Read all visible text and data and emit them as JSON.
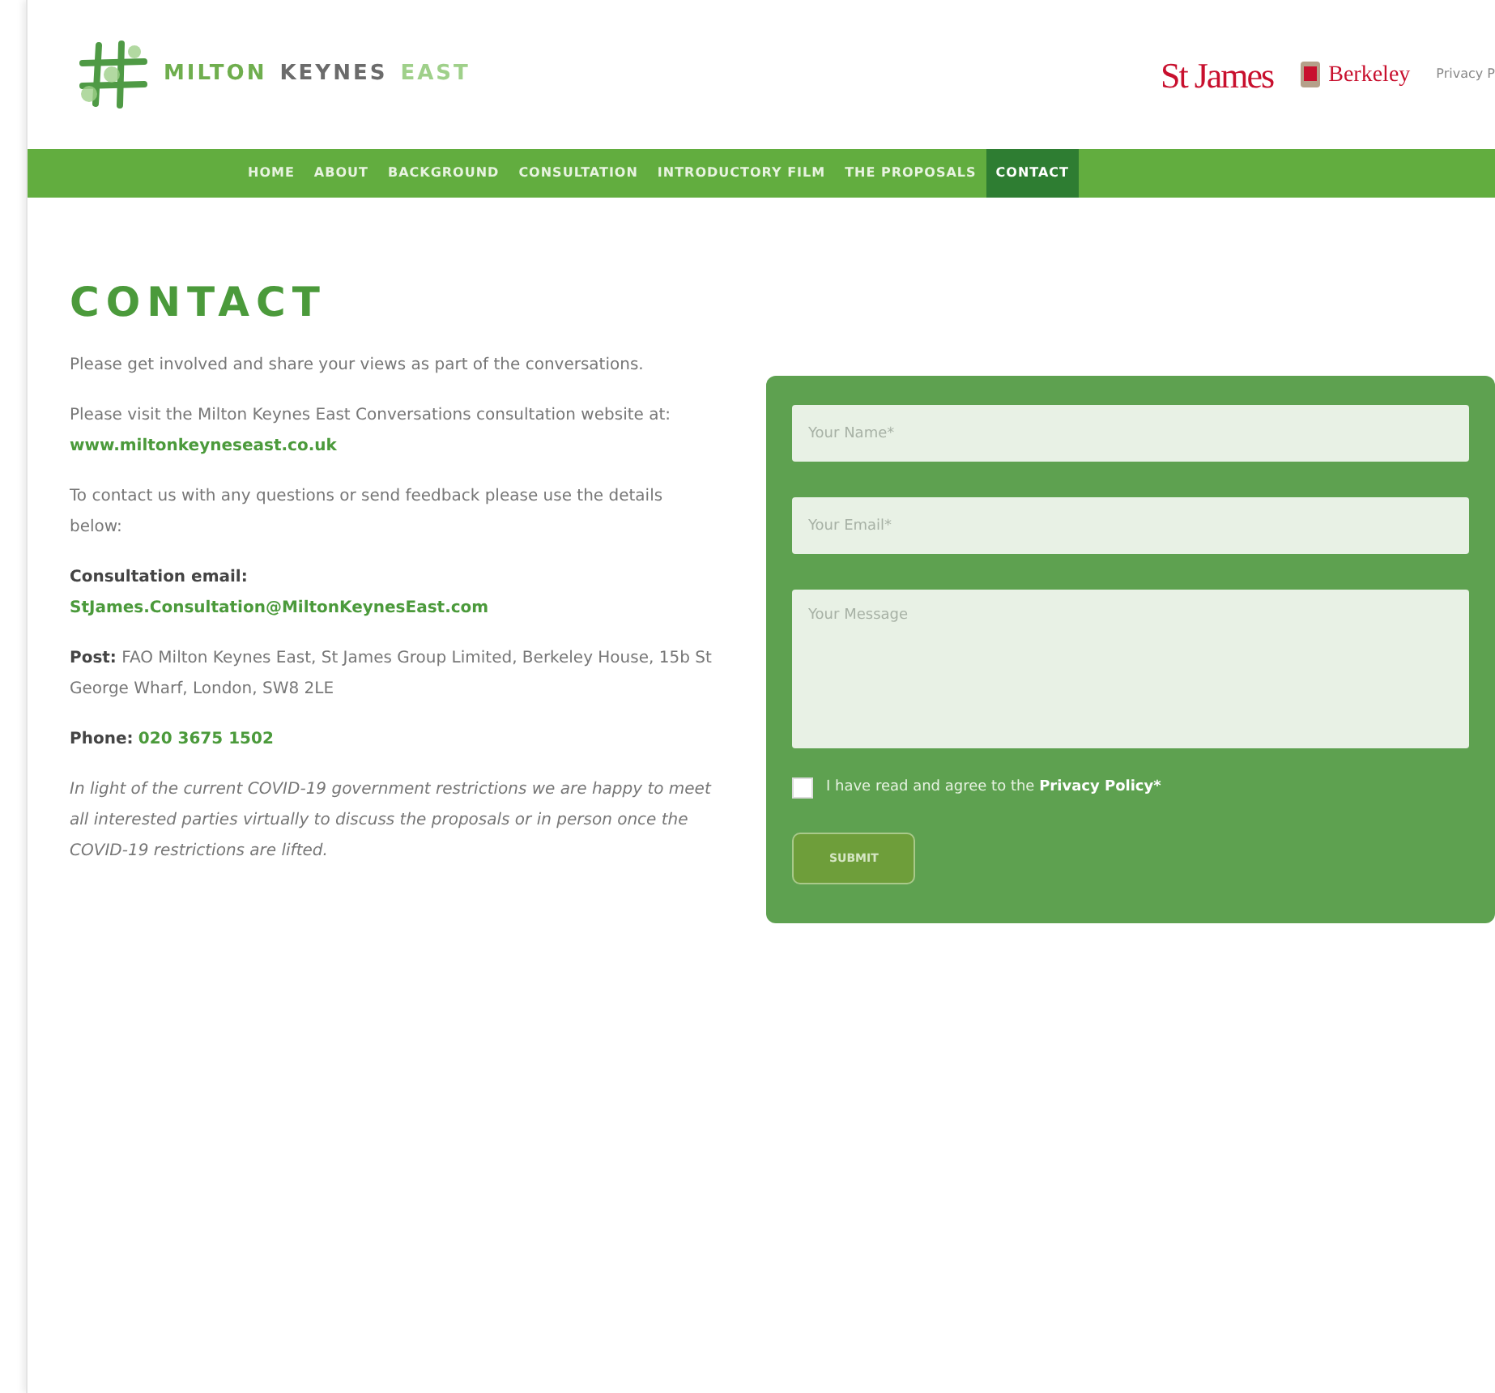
{
  "header": {
    "logo_words": [
      {
        "text": "MILTON",
        "color": "#6fae4e"
      },
      {
        "text": "KEYNES",
        "color": "#6b6b6b"
      },
      {
        "text": "EAST",
        "color": "#9fd08a"
      }
    ],
    "partners": [
      {
        "kind": "stjames",
        "text": "St James"
      },
      {
        "kind": "berkeley",
        "text": "Berkeley"
      }
    ],
    "privacy_link": "Privacy P"
  },
  "nav": [
    {
      "label": "HOME",
      "selected": false
    },
    {
      "label": "ABOUT",
      "selected": false
    },
    {
      "label": "BACKGROUND",
      "selected": false
    },
    {
      "label": "CONSULTATION",
      "selected": false
    },
    {
      "label": "INTRODUCTORY FILM",
      "selected": false
    },
    {
      "label": "THE PROPOSALS",
      "selected": false
    },
    {
      "label": "CONTACT",
      "selected": true
    }
  ],
  "content": {
    "heading": "CONTACT",
    "blocks": [
      {
        "kind": "text",
        "text": "Please get involved and share your views as part of the conversations."
      },
      {
        "kind": "text",
        "text": "Please visit the Milton Keynes East Conversations consultation website at: ",
        "link": "www.miltonkeyneseast.co.uk"
      },
      {
        "kind": "text",
        "text": "To contact us with any questions or send feedback please use the details below:"
      },
      {
        "kind": "email",
        "label": "Consultation email:",
        "link": "StJames.Consultation@MiltonKeynesEast.com"
      },
      {
        "kind": "labelled",
        "label": "Post:",
        "text": " FAO Milton Keynes East, St James Group Limited, Berkeley House, 15b St George Wharf, London, SW8 2LE"
      },
      {
        "kind": "labelled",
        "label": "Phone:",
        "link": "020 3675 1502"
      },
      {
        "kind": "note",
        "text": "In light of the current COVID-19 government restrictions we are happy to meet all interested parties virtually to discuss the proposals or in person once the COVID-19 restrictions are lifted."
      }
    ]
  },
  "form": {
    "fields": [
      {
        "kind": "input",
        "placeholder": "Your Name*"
      },
      {
        "kind": "input",
        "placeholder": "Your Email*"
      },
      {
        "kind": "textarea",
        "placeholder": "Your Message"
      }
    ],
    "consent": {
      "checked": false,
      "text": "I have read and agree to the ",
      "link": "Privacy Policy*"
    },
    "submit": "SUBMIT"
  }
}
